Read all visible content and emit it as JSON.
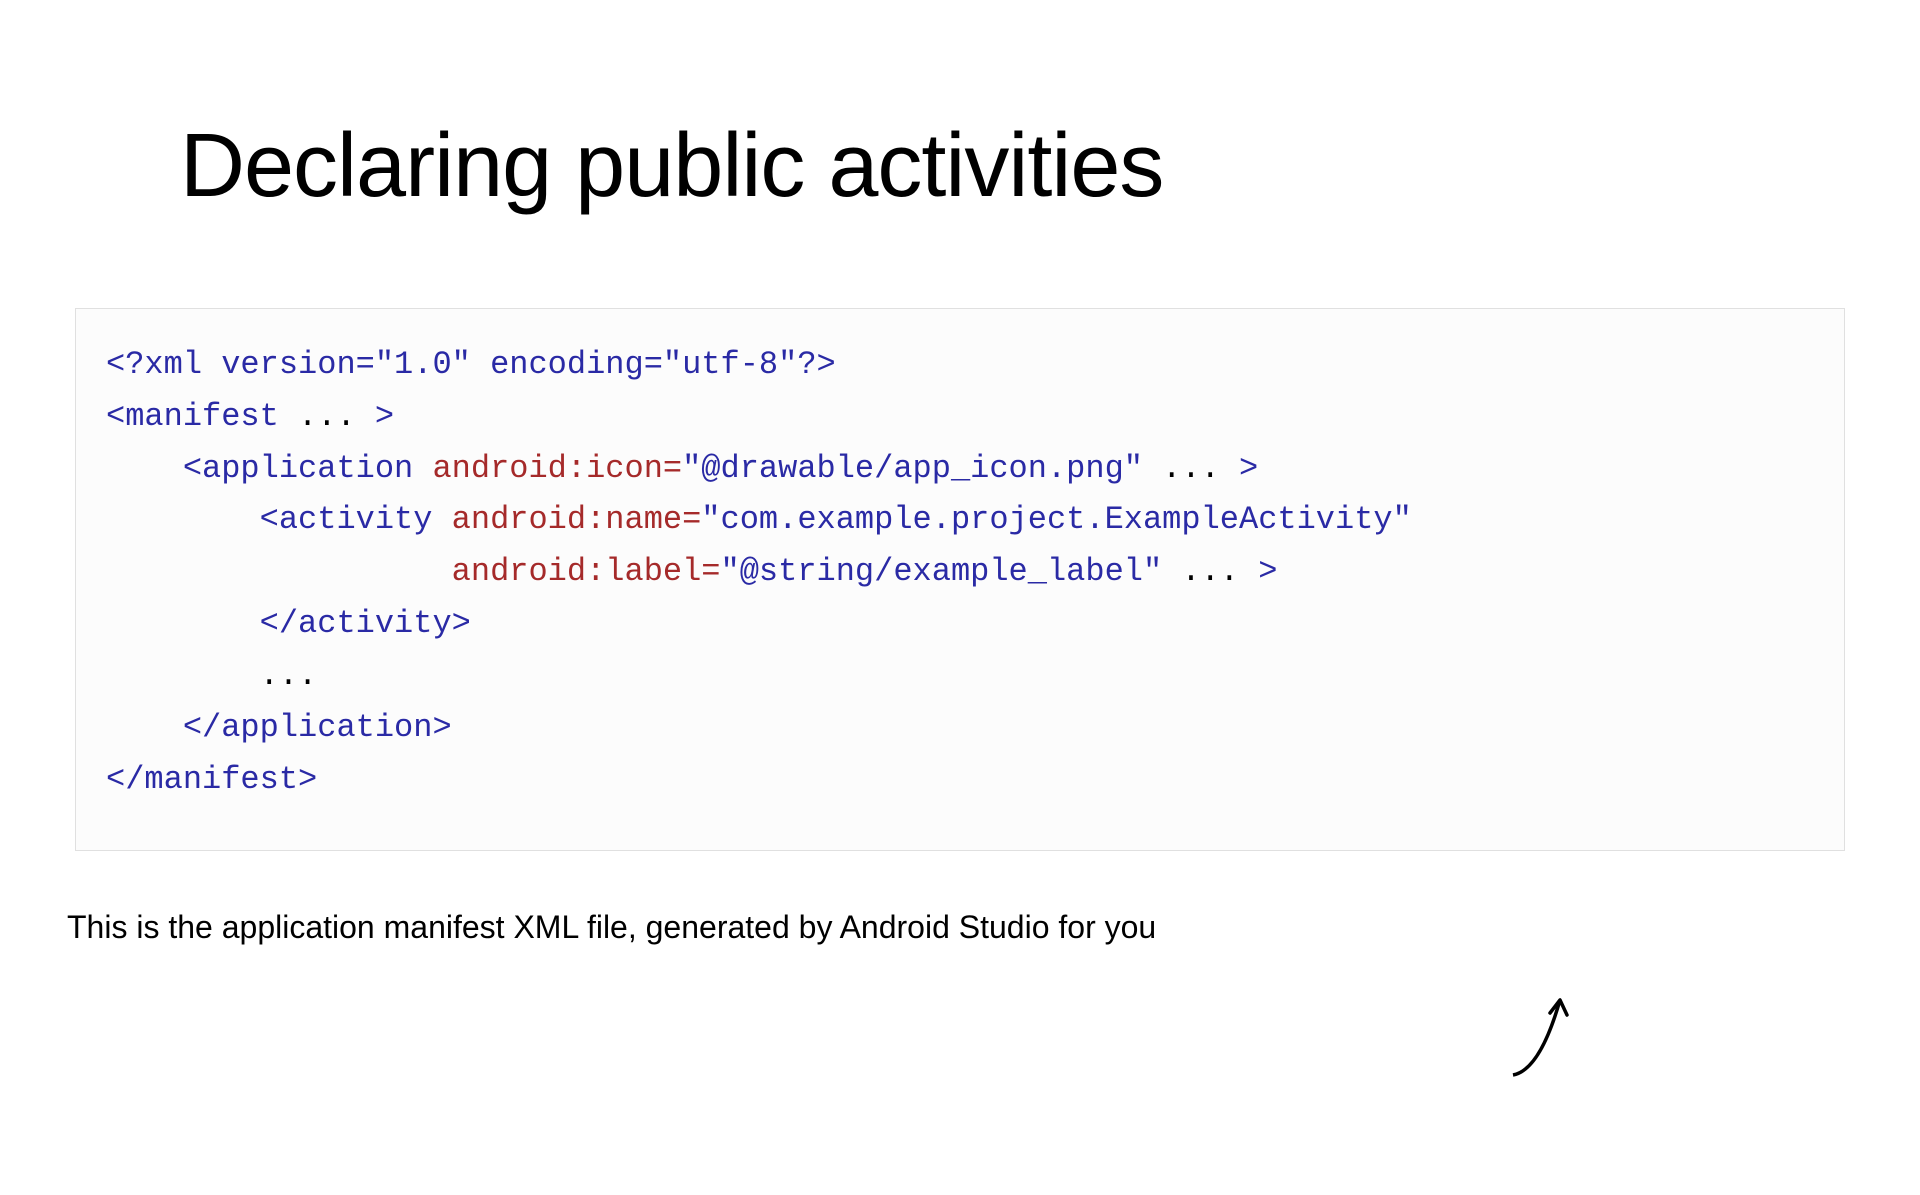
{
  "title": "Declaring public activities",
  "code": {
    "line1_a": "<?xml version=",
    "line1_b": "\"1.0\"",
    "line1_c": " encoding=",
    "line1_d": "\"utf-8\"",
    "line1_e": "?>",
    "line2_a": "<manifest",
    "line2_b": " ... ",
    "line2_c": ">",
    "line3_a": "    <application",
    "line3_b": " android:icon=",
    "line3_c": "\"@drawable/app_icon.png\"",
    "line3_d": " ... ",
    "line3_e": ">",
    "line4_a": "        <activity",
    "line4_b": " android:name=",
    "line4_c": "\"com.example.project.ExampleActivity\"",
    "line5_a": "                 ",
    "line5_b": " android:label=",
    "line5_c": "\"@string/example_label\"",
    "line5_d": " ... ",
    "line5_e": ">",
    "line6": "        </activity>",
    "line7": "        ...",
    "line8": "    </application>",
    "line9": "</manifest>"
  },
  "caption": "This is the application manifest XML file, generated by Android Studio for you"
}
